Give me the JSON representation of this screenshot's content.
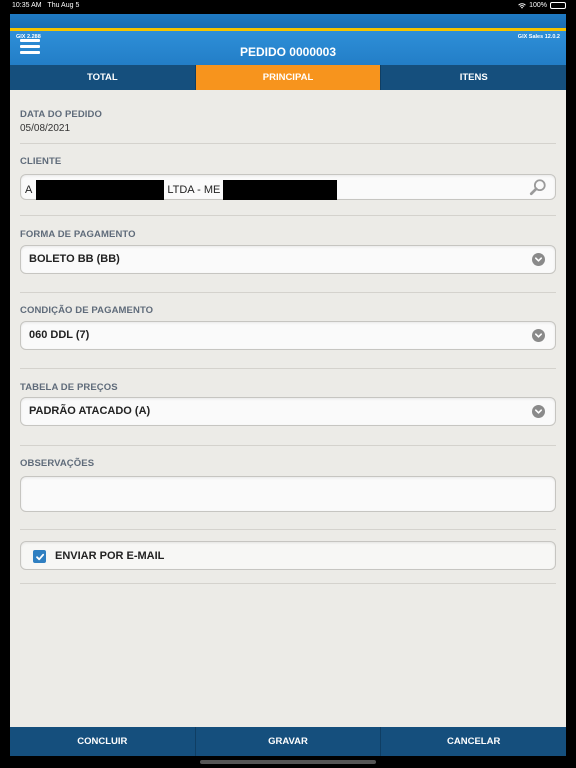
{
  "status_bar": {
    "time": "10:35 AM",
    "date": "Thu Aug 5",
    "battery": "100%"
  },
  "header": {
    "version_left": "GIX 2.288",
    "version_right": "GIX Sales 12.0.2",
    "title": "PEDIDO 0000003"
  },
  "tabs": [
    {
      "label": "TOTAL",
      "active": false
    },
    {
      "label": "PRINCIPAL",
      "active": true
    },
    {
      "label": "ITENS",
      "active": false
    }
  ],
  "form": {
    "data_pedido": {
      "label": "DATA DO PEDIDO",
      "value": "05/08/2021"
    },
    "cliente": {
      "label": "CLIENTE",
      "prefix": "A",
      "middle": "LTDA - ME"
    },
    "forma_pagamento": {
      "label": "FORMA DE PAGAMENTO",
      "value": "BOLETO BB (BB)"
    },
    "condicao_pagamento": {
      "label": "CONDIÇÃO DE PAGAMENTO",
      "value": "060 DDL (7)"
    },
    "tabela_precos": {
      "label": "TABELA DE PREÇOS",
      "value": "PADRÃO ATACADO (A)"
    },
    "observacoes": {
      "label": "OBSERVAÇÕES",
      "value": ""
    },
    "enviar_email": {
      "label": "ENVIAR POR E-MAIL",
      "checked": true
    }
  },
  "footer": {
    "concluir": "CONCLUIR",
    "gravar": "GRAVAR",
    "cancelar": "CANCELAR"
  },
  "colors": {
    "accent": "#f7941d",
    "header": "#1e77c0",
    "tabbar": "#154f7d",
    "background": "#ecebe7"
  }
}
